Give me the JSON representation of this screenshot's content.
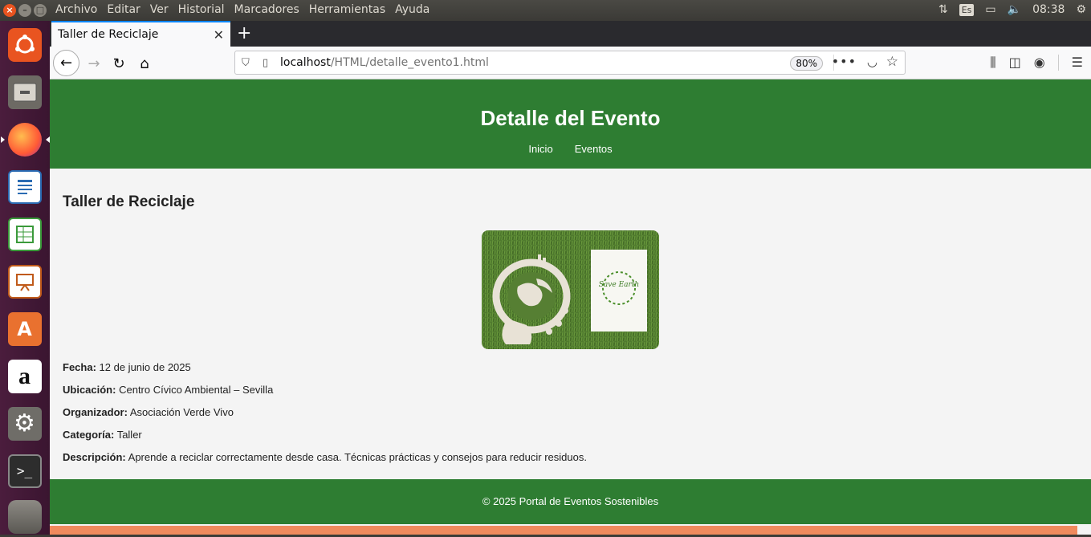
{
  "topbar": {
    "menu": [
      "Archivo",
      "Editar",
      "Ver",
      "Historial",
      "Marcadores",
      "Herramientas",
      "Ayuda"
    ],
    "keyboard_layout": "Es",
    "clock": "08:38"
  },
  "launcher": {
    "items": [
      "ubuntu-icon",
      "files-icon",
      "firefox-icon",
      "writer-icon",
      "calc-icon",
      "impress-icon",
      "software-center-icon",
      "amazon-icon",
      "settings-icon",
      "terminal-icon",
      "trash-icon"
    ]
  },
  "browser": {
    "tab_title": "Taller de Reciclaje",
    "url_host": "localhost",
    "url_path": "/HTML/detalle_evento1.html",
    "zoom": "80%"
  },
  "page": {
    "header_title": "Detalle del Evento",
    "nav": [
      "Inicio",
      "Eventos"
    ],
    "event_title": "Taller de Reciclaje",
    "image_text": "Save Earth",
    "fields": [
      {
        "label": "Fecha:",
        "value": "12 de junio de 2025"
      },
      {
        "label": "Ubicación:",
        "value": "Centro Cívico Ambiental – Sevilla"
      },
      {
        "label": "Organizador:",
        "value": "Asociación Verde Vivo"
      },
      {
        "label": "Categoría:",
        "value": "Taller"
      },
      {
        "label": "Descripción:",
        "value": "Aprende a reciclar correctamente desde casa. Técnicas prácticas y consejos para reducir residuos."
      }
    ],
    "footer": "© 2025 Portal de Eventos Sostenibles"
  },
  "colors": {
    "header_green": "#2e7d32",
    "ubuntu_orange": "#e95420",
    "launcher_purple": "#4b1d3d"
  }
}
